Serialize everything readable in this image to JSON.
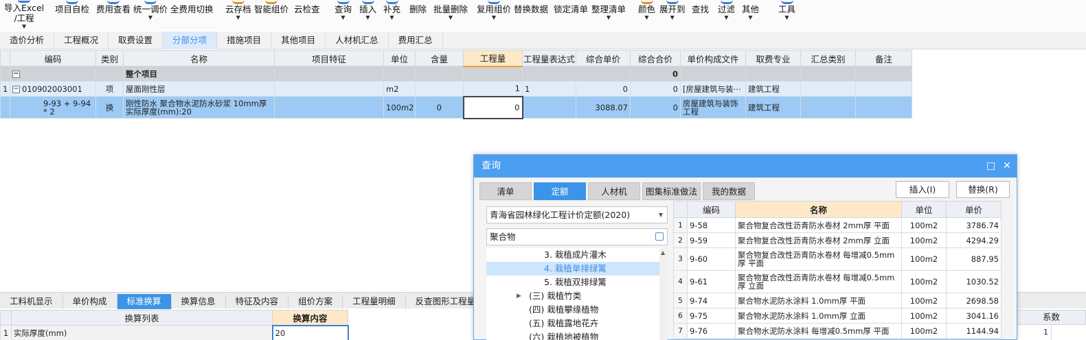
{
  "toolbar": [
    {
      "label": "导入Excel",
      "label2": "/工程",
      "caret": true
    },
    {
      "label": "项目自检"
    },
    {
      "label": "费用查看"
    },
    {
      "label": "统一调价",
      "caret": true
    },
    {
      "label": "全费用切换"
    },
    {
      "label": "云存档",
      "caret": true
    },
    {
      "label": "智能组价"
    },
    {
      "label": "云检查"
    },
    {
      "label": "查询",
      "caret": true
    },
    {
      "label": "插入",
      "caret": true
    },
    {
      "label": "补充",
      "caret": true
    },
    {
      "label": "删除"
    },
    {
      "label": "批量删除",
      "caret": true
    },
    {
      "label": "复用组价",
      "caret": true
    },
    {
      "label": "替换数据"
    },
    {
      "label": "锁定清单"
    },
    {
      "label": "整理清单",
      "caret": true
    },
    {
      "label": "颜色",
      "caret": true
    },
    {
      "label": "展开到",
      "caret": true
    },
    {
      "label": "查找"
    },
    {
      "label": "过滤",
      "caret": true
    },
    {
      "label": "其他",
      "caret": true
    },
    {
      "label": "工具",
      "caret": true
    }
  ],
  "main_tabs": [
    "造价分析",
    "工程概况",
    "取费设置",
    "分部分项",
    "措施项目",
    "其他项目",
    "人材机汇总",
    "费用汇总"
  ],
  "grid": {
    "headers": [
      "编码",
      "类别",
      "名称",
      "项目特征",
      "单位",
      "含量",
      "工程量",
      "工程量表达式",
      "综合单价",
      "综合合价",
      "单价构成文件",
      "取费专业",
      "汇总类别",
      "备注"
    ],
    "whole": {
      "toggle": "−",
      "name": "整个项目",
      "total": "0"
    },
    "item": {
      "index": "1",
      "toggle": "−",
      "code": "010902003001",
      "type": "项",
      "name": "屋面刚性层",
      "unit": "m2",
      "qty": "1",
      "expr": "1",
      "unit_price": "0",
      "total": "0",
      "price_file": "[房屋建筑与装⋯",
      "fee_major": "建筑工程"
    },
    "sub": {
      "code": "9-93 + 9-94 * 2",
      "type": "换",
      "name": "刚性防水 聚合物水泥防水砂浆 10mm厚 实际厚度(mm):20",
      "unit": "100m2",
      "content": "0",
      "qty": "0",
      "unit_price": "3088.07",
      "total": "0",
      "price_file": "房屋建筑与装饰工程",
      "fee_major": "建筑工程"
    }
  },
  "bottom_tabs": [
    "工料机显示",
    "单价构成",
    "标准换算",
    "换算信息",
    "特征及内容",
    "组价方案",
    "工程量明细",
    "反查图形工程量"
  ],
  "sub_grid": {
    "headers": [
      "换算列表",
      "换算内容"
    ],
    "rows": [
      {
        "index": "1",
        "name": "实际厚度(mm)",
        "value": "20"
      }
    ],
    "right_header": "系数",
    "right_value": "1"
  },
  "dialog": {
    "title": "查询",
    "maximize": "□",
    "close": "✕",
    "tabs": [
      "清单",
      "定额",
      "人材机",
      "图集标准做法",
      "我的数据"
    ],
    "insert_button": "插入(I)",
    "replace_button": "替换(R)",
    "library": "青海省园林绿化工程计价定额(2020)",
    "search_value": "聚合物",
    "tree": [
      {
        "label": "3. 栽植成片灌木",
        "indent": 2
      },
      {
        "label": "4. 栽植单排绿篱",
        "indent": 2,
        "selected": true
      },
      {
        "label": "5. 栽植双排绿篱",
        "indent": 2
      },
      {
        "label": "(三) 栽植竹类",
        "indent": 1,
        "expandable": true
      },
      {
        "label": "(四) 栽植攀缘植物",
        "indent": 1
      },
      {
        "label": "(五) 栽植露地花卉",
        "indent": 1
      },
      {
        "label": "(六) 栽植地被植物",
        "indent": 1
      }
    ],
    "headers": [
      "编码",
      "名称",
      "单位",
      "单价"
    ],
    "rows": [
      {
        "index": "1",
        "code": "9-58",
        "name": "聚合物复合改性沥青防水卷材 2mm厚 平面",
        "unit": "100m2",
        "price": "3786.74"
      },
      {
        "index": "2",
        "code": "9-59",
        "name": "聚合物复合改性沥青防水卷材 2mm厚 立面",
        "unit": "100m2",
        "price": "4294.29"
      },
      {
        "index": "3",
        "code": "9-60",
        "name": "聚合物复合改性沥青防水卷材 每增减0.5mm厚 平面",
        "unit": "100m2",
        "price": "887.95"
      },
      {
        "index": "4",
        "code": "9-61",
        "name": "聚合物复合改性沥青防水卷材 每增减0.5mm厚 立面",
        "unit": "100m2",
        "price": "1030.52"
      },
      {
        "index": "5",
        "code": "9-74",
        "name": "聚合物水泥防水涂料 1.0mm厚 平面",
        "unit": "100m2",
        "price": "2698.58"
      },
      {
        "index": "6",
        "code": "9-75",
        "name": "聚合物水泥防水涂料 1.0mm厚 立面",
        "unit": "100m2",
        "price": "3041.16"
      },
      {
        "index": "7",
        "code": "9-76",
        "name": "聚合物水泥防水涂料 每增减0.5mm厚 平面",
        "unit": "100m2",
        "price": "1144.94"
      }
    ]
  }
}
